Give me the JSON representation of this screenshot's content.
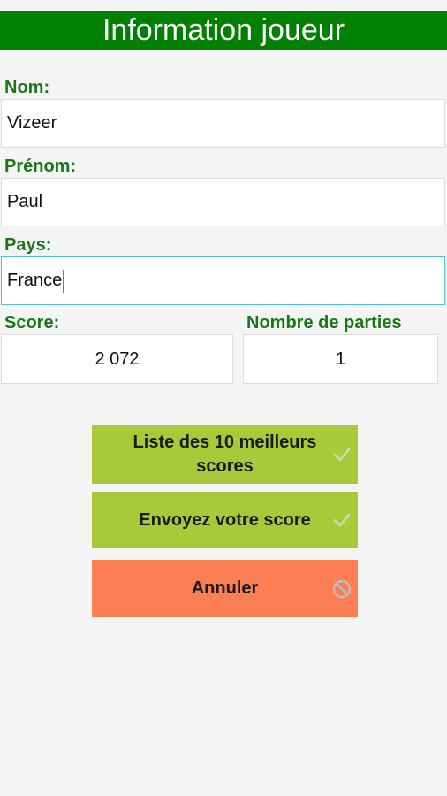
{
  "header": {
    "title": "Information joueur"
  },
  "form": {
    "nom": {
      "label": "Nom:",
      "value": "Vizeer"
    },
    "prenom": {
      "label": "Prénom:",
      "value": "Paul"
    },
    "pays": {
      "label": "Pays:",
      "value": "France"
    },
    "score": {
      "label": "Score:",
      "value": "2 072"
    },
    "parties": {
      "label": "Nombre de parties",
      "value": "1"
    }
  },
  "buttons": {
    "top10": {
      "label": "Liste des 10 meilleurs scores",
      "icon": "check-icon"
    },
    "send": {
      "label": "Envoyez votre score",
      "icon": "check-icon"
    },
    "cancel": {
      "label": "Annuler",
      "icon": "cancel-icon"
    }
  },
  "colors": {
    "header": "#008000",
    "label": "#187818",
    "primary_button": "#a9c93a",
    "cancel_button": "#fb7f52",
    "focus_border": "#4fc3d6"
  }
}
